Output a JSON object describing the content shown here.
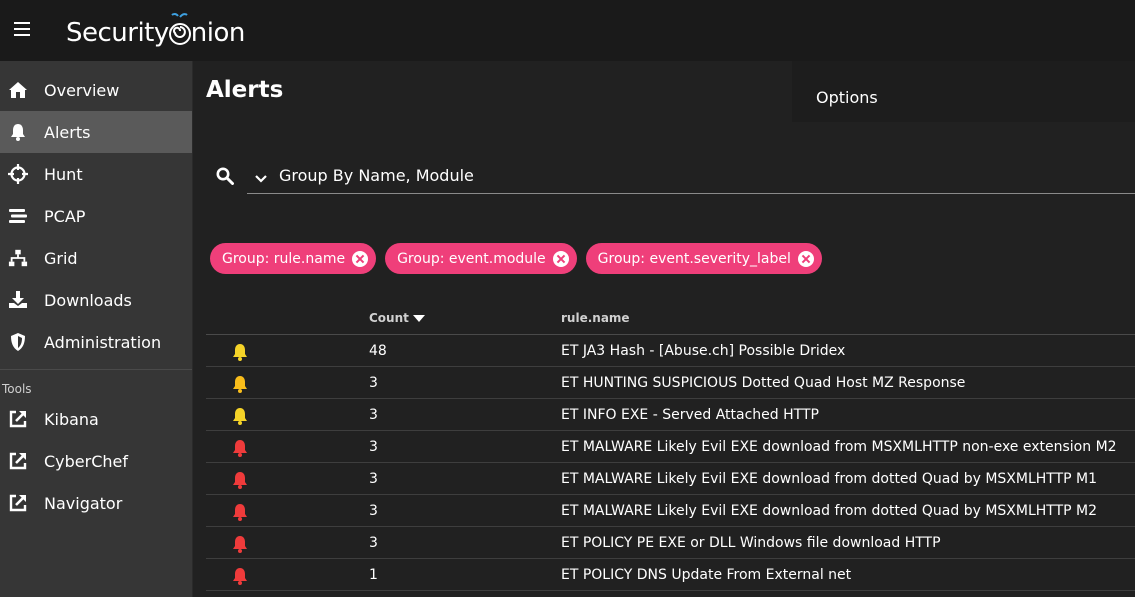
{
  "brand": {
    "name_part1": "Security",
    "name_part2": "nion"
  },
  "sidebar": {
    "items": [
      {
        "label": "Overview",
        "icon": "home-icon"
      },
      {
        "label": "Alerts",
        "icon": "bell-icon"
      },
      {
        "label": "Hunt",
        "icon": "crosshairs-icon"
      },
      {
        "label": "PCAP",
        "icon": "stream-icon"
      },
      {
        "label": "Grid",
        "icon": "sitemap-icon"
      },
      {
        "label": "Downloads",
        "icon": "download-icon"
      },
      {
        "label": "Administration",
        "icon": "shield-icon"
      }
    ],
    "tools_label": "Tools",
    "tools": [
      {
        "label": "Kibana",
        "icon": "external-link-icon"
      },
      {
        "label": "CyberChef",
        "icon": "external-link-icon"
      },
      {
        "label": "Navigator",
        "icon": "external-link-icon"
      }
    ]
  },
  "page": {
    "title": "Alerts",
    "options_label": "Options"
  },
  "query": {
    "text": "Group By Name, Module"
  },
  "chips": [
    "Group: rule.name",
    "Group: event.module",
    "Group: event.severity_label"
  ],
  "table": {
    "headers": {
      "count": "Count",
      "rule": "rule.name"
    },
    "rows": [
      {
        "severity": "medium",
        "count": "48",
        "rule": "ET JA3 Hash - [Abuse.ch] Possible Dridex"
      },
      {
        "severity": "medium-orange",
        "count": "3",
        "rule": "ET HUNTING SUSPICIOUS Dotted Quad Host MZ Response"
      },
      {
        "severity": "medium",
        "count": "3",
        "rule": "ET INFO EXE - Served Attached HTTP"
      },
      {
        "severity": "high",
        "count": "3",
        "rule": "ET MALWARE Likely Evil EXE download from MSXMLHTTP non-exe extension M2"
      },
      {
        "severity": "high",
        "count": "3",
        "rule": "ET MALWARE Likely Evil EXE download from dotted Quad by MSXMLHTTP M1"
      },
      {
        "severity": "high",
        "count": "3",
        "rule": "ET MALWARE Likely Evil EXE download from dotted Quad by MSXMLHTTP M2"
      },
      {
        "severity": "high",
        "count": "3",
        "rule": "ET POLICY PE EXE or DLL Windows file download HTTP"
      },
      {
        "severity": "high",
        "count": "1",
        "rule": "ET POLICY DNS Update From External net"
      }
    ]
  },
  "colors": {
    "medium": "#f5d328",
    "medium-orange": "#f9bd1b",
    "high": "#ef3b3b",
    "chip": "#ef3f7a"
  }
}
